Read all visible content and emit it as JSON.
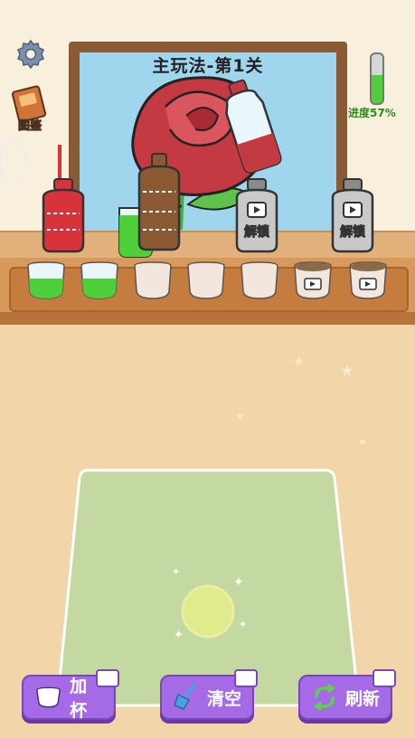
{
  "header": {
    "title": "主玩法-第1关",
    "progress_label": "进度57%",
    "progress_value": 0.57,
    "book_label": "图鉴",
    "settings_icon": "gear-icon"
  },
  "shelf": {
    "bottles": [
      {
        "id": "red",
        "color": "#d8323a",
        "locked": false
      },
      {
        "id": "brown",
        "color": "#8b5a34",
        "locked": false
      },
      {
        "id": "grey-locked-1",
        "color": "#8a8a8a",
        "locked": true,
        "label": "解锁"
      },
      {
        "id": "grey-locked-2",
        "color": "#8a8a8a",
        "locked": true,
        "label": "解锁"
      }
    ],
    "cups": [
      {
        "state": "green"
      },
      {
        "state": "green"
      },
      {
        "state": "empty"
      },
      {
        "state": "empty"
      },
      {
        "state": "empty"
      },
      {
        "state": "locked-video"
      },
      {
        "state": "locked-video"
      }
    ]
  },
  "buttons": {
    "add_cup": "加杯",
    "clear": "清空",
    "refresh": "刷新"
  },
  "colors": {
    "accent_button": "#a56ae6",
    "progress": "#4fcf3c",
    "table": "#c4d9a2"
  }
}
